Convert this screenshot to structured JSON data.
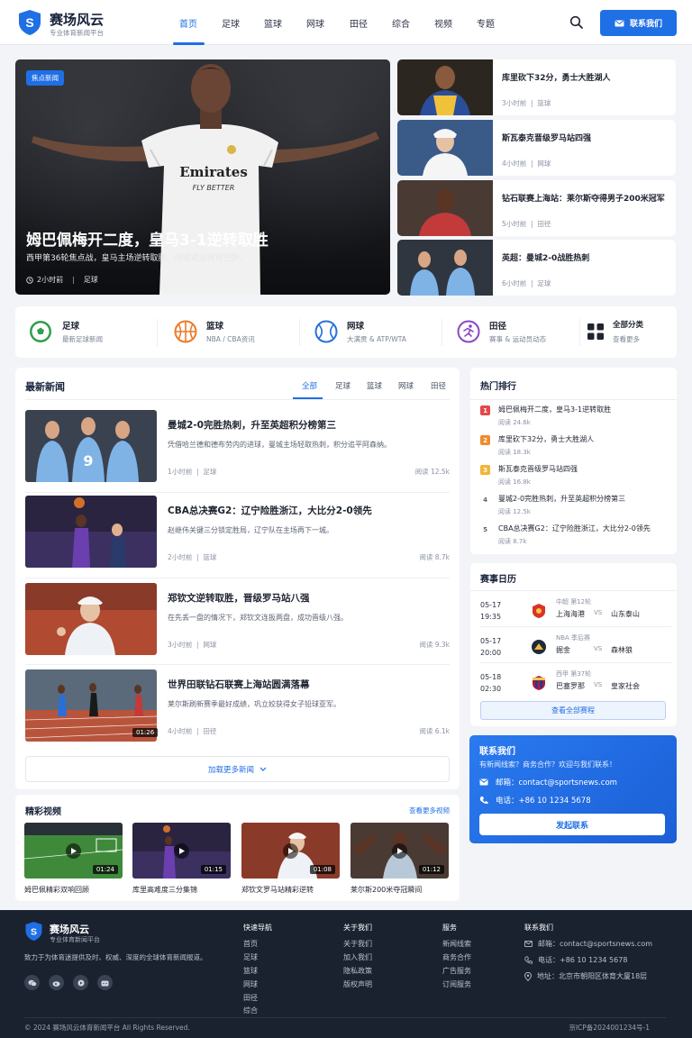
{
  "colors": {
    "primary": "#1f6fe5",
    "footer": "#1a2230",
    "rank1": "#e54848",
    "rank2": "#f08b2c",
    "rank3": "#f2b53a"
  },
  "header": {
    "logo_icon": "shield-s-logo",
    "brand_name": "赛场风云",
    "brand_sub": "专业体育新闻平台",
    "nav": [
      "首页",
      "足球",
      "篮球",
      "网球",
      "田径",
      "综合",
      "视频",
      "专题"
    ],
    "active_nav": "首页",
    "search_icon": "search-icon",
    "contact_label": "联系我们"
  },
  "hero": {
    "badge": "焦点新闻",
    "title": "姆巴佩梅开二度，皇马3-1逆转取胜",
    "subtitle": "西甲第36轮焦点战，皇马主场逆转取胜，继续紧追榜首巴萨。",
    "time": "2小时前",
    "category": "足球"
  },
  "side_news": [
    {
      "title": "库里砍下32分，勇士大胜湖人",
      "time": "3小时前",
      "category": "篮球"
    },
    {
      "title": "斯瓦泰克晋级罗马站四强",
      "time": "4小时前",
      "category": "网球"
    },
    {
      "title": "钻石联赛上海站：莱尔斯夺得男子200米冠军",
      "time": "5小时前",
      "category": "田径"
    },
    {
      "title": "英超：曼城2-0战胜热刺",
      "time": "6小时前",
      "category": "足球"
    }
  ],
  "categories": [
    {
      "icon": "soccer-ball-icon",
      "title": "足球",
      "sub": "最新足球新闻"
    },
    {
      "icon": "basketball-icon",
      "title": "篮球",
      "sub": "NBA / CBA资讯"
    },
    {
      "icon": "tennis-ball-icon",
      "title": "网球",
      "sub": "大满贯 & ATP/WTA"
    },
    {
      "icon": "runner-icon",
      "title": "田径",
      "sub": "赛事 & 运动员动态"
    },
    {
      "icon": "grid-icon",
      "title": "全部分类",
      "sub": "查看更多"
    }
  ],
  "latest": {
    "title": "最新新闻",
    "tabs": [
      "全部",
      "足球",
      "篮球",
      "网球",
      "田径"
    ],
    "active_tab": "全部",
    "items": [
      {
        "title": "曼城2-0完胜热刺，升至英超积分榜第三",
        "desc": "凭借哈兰德和德布劳内的进球，曼城主场轻取热刺，积分追平阿森纳。",
        "time": "1小时前",
        "category": "足球",
        "reads": "阅读 12.5k"
      },
      {
        "title": "CBA总决赛G2：辽宁险胜浙江，大比分2-0领先",
        "desc": "赵继伟关键三分锁定胜局，辽宁队在主场再下一城。",
        "time": "2小时前",
        "category": "篮球",
        "reads": "阅读 8.7k"
      },
      {
        "title": "郑钦文逆转取胜，晋级罗马站八强",
        "desc": "在先丢一盘的情况下，郑钦文连扳两盘，成功晋级八强。",
        "time": "3小时前",
        "category": "网球",
        "reads": "阅读 9.3k"
      },
      {
        "title": "世界田联钻石联赛上海站圆满落幕",
        "desc": "莱尔斯刷新赛季最好成绩，巩立姣获得女子铅球亚军。",
        "time": "4小时前",
        "category": "田径",
        "reads": "阅读 6.1k",
        "duration": "01:26"
      }
    ],
    "load_more": "加载更多新闻"
  },
  "videos": {
    "title": "精彩视频",
    "more": "查看更多视频",
    "items": [
      {
        "title": "姆巴佩精彩双响回顾",
        "duration": "01:24"
      },
      {
        "title": "库里高难度三分集锦",
        "duration": "01:15"
      },
      {
        "title": "郑钦文罗马站精彩逆转",
        "duration": "01:08"
      },
      {
        "title": "莱尔斯200米夺冠瞬间",
        "duration": "01:12"
      }
    ]
  },
  "hot": {
    "title": "热门排行",
    "items": [
      {
        "rank": "1",
        "title": "姆巴佩梅开二度，皇马3-1逆转取胜",
        "reads": "阅读 24.6k"
      },
      {
        "rank": "2",
        "title": "库里砍下32分，勇士大胜湖人",
        "reads": "阅读 18.3k"
      },
      {
        "rank": "3",
        "title": "斯瓦泰克晋级罗马站四强",
        "reads": "阅读 16.8k"
      },
      {
        "rank": "4",
        "title": "曼城2-0完胜热刺，升至英超积分榜第三",
        "reads": "阅读 12.5k"
      },
      {
        "rank": "5",
        "title": "CBA总决赛G2：辽宁险胜浙江，大比分2-0领先",
        "reads": "阅读 8.7k"
      }
    ]
  },
  "schedule": {
    "title": "赛事日历",
    "matches": [
      {
        "date": "05-17",
        "time": "19:35",
        "league": "中超 第12轮",
        "home": "上海海港",
        "vs": "VS",
        "away": "山东泰山"
      },
      {
        "date": "05-17",
        "time": "20:00",
        "league": "NBA 季后赛",
        "home": "掘金",
        "vs": "VS",
        "away": "森林狼"
      },
      {
        "date": "05-18",
        "time": "02:30",
        "league": "西甲 第37轮",
        "home": "巴塞罗那",
        "vs": "VS",
        "away": "皇家社会"
      }
    ],
    "button": "查看全部赛程"
  },
  "contact": {
    "title": "联系我们",
    "sub": "有新闻线索？商务合作？欢迎与我们联系！",
    "email": "邮箱：contact@sportsnews.com",
    "phone": "电话：+86 10 1234 5678",
    "button": "发起联系"
  },
  "footer": {
    "brand_name": "赛场风云",
    "brand_sub": "专业体育新闻平台",
    "desc": "致力于为体育迷提供及时、权威、深度的全球体育新闻报道。",
    "social": [
      "wechat-icon",
      "weibo-icon",
      "douyin-icon",
      "bilibili-icon"
    ],
    "cols": [
      {
        "title": "快速导航",
        "links": [
          "首页",
          "足球",
          "篮球",
          "网球",
          "田径",
          "综合"
        ]
      },
      {
        "title": "关于我们",
        "links": [
          "关于我们",
          "加入我们",
          "隐私政策",
          "版权声明"
        ]
      },
      {
        "title": "服务",
        "links": [
          "新闻线索",
          "商务合作",
          "广告服务",
          "订阅服务"
        ]
      }
    ],
    "contact_title": "联系我们",
    "contact": [
      "邮箱：contact@sportsnews.com",
      "电话：+86 10 1234 5678",
      "地址：北京市朝阳区体育大厦18层"
    ],
    "copyright": "© 2024 赛场风云体育新闻平台 All Rights Reserved.",
    "icp": "京ICP备2024001234号-1"
  }
}
